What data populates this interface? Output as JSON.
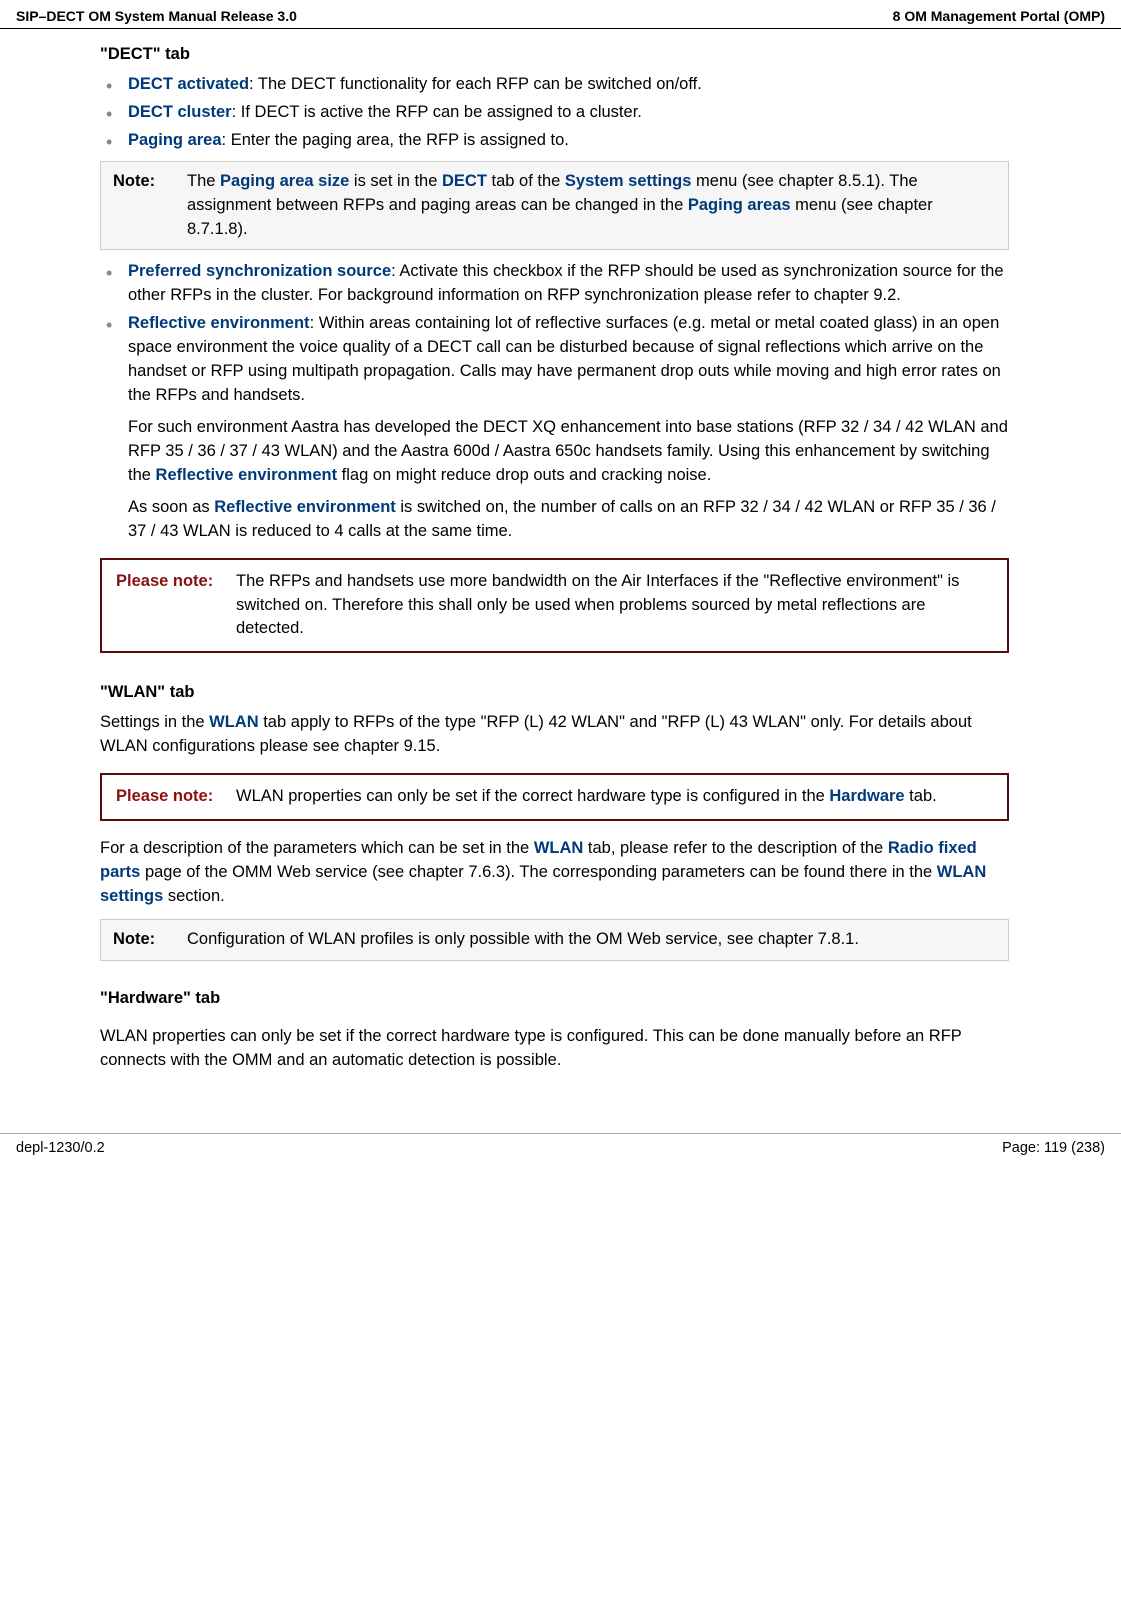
{
  "header": {
    "left": "SIP–DECT OM System Manual Release 3.0",
    "right": "8 OM Management Portal (OMP)"
  },
  "sections": {
    "dectTab": {
      "title": "\"DECT\" tab",
      "items": {
        "dectActivated": {
          "term": "DECT activated",
          "text": ": The DECT functionality for each RFP can be switched on/off."
        },
        "dectCluster": {
          "term": "DECT cluster",
          "text": ": If DECT is active the RFP can be assigned to a cluster."
        },
        "pagingArea": {
          "term": "Paging area",
          "text": ": Enter the paging area, the RFP is assigned to."
        },
        "prefSync": {
          "term": "Preferred synchronization source",
          "text": ": Activate this checkbox if the RFP should be used as synchronization source for the other RFPs in the cluster. For background information on RFP synchronization please refer to chapter 9.2."
        },
        "reflective": {
          "term": "Reflective environment",
          "text": ": Within areas containing lot of reflective surfaces (e.g. metal or metal coated glass) in an open space environment the voice quality of a DECT call can be disturbed because of signal reflections which arrive on the handset or RFP using multipath propagation. Calls may have permanent drop outs while moving and high error rates on the RFPs and handsets."
        }
      },
      "continuations": {
        "p1_a": "For such environment Aastra has developed the DECT XQ enhancement into base stations (RFP 32 / 34 / 42 WLAN and RFP 35 / 36 / 37 / 43 WLAN) and the Aastra 600d / Aastra 650c handsets family. Using this enhancement by switching the ",
        "p1_term": "Reflective environment",
        "p1_b": " flag on might reduce drop outs and cracking noise.",
        "p2_a": "As soon as ",
        "p2_term": "Reflective environment",
        "p2_b": " is switched on, the number of calls on an RFP 32 / 34 / 42 WLAN or RFP 35 / 36 / 37 / 43 WLAN is reduced to 4 calls at the same time."
      }
    },
    "note1": {
      "label": "Note:",
      "a": "The ",
      "t1": "Paging area size",
      "b": " is set in the ",
      "t2": "DECT",
      "c": " tab of the ",
      "t3": "System settings",
      "d": " menu (see chapter 8.5.1). The assignment between RFPs and paging areas can be changed in the ",
      "t4": "Paging areas",
      "e": " menu (see chapter 8.7.1.8)."
    },
    "pleaseNote1": {
      "label": "Please note:",
      "text": "The RFPs and handsets use more bandwidth on the Air Interfaces if the \"Reflective environment\" is switched on. Therefore this shall only be used when problems sourced by metal reflections are detected."
    },
    "wlanTab": {
      "title": "\"WLAN\" tab",
      "intro_a": "Settings in the ",
      "intro_t1": "WLAN",
      "intro_b": " tab apply to RFPs of the type \"RFP (L) 42 WLAN\" and \"RFP (L) 43 WLAN\" only. For details about WLAN configurations please see chapter 9.15.",
      "desc_a": "For a description of the parameters which can be set in the ",
      "desc_t1": "WLAN",
      "desc_b": " tab, please refer to the description of the ",
      "desc_t2": "Radio fixed parts",
      "desc_c": " page of the OMM Web service (see chapter 7.6.3). The corresponding parameters can be found there in the ",
      "desc_t3": "WLAN settings",
      "desc_d": " section."
    },
    "pleaseNote2": {
      "label": "Please note:",
      "a": "WLAN properties can only be set if the correct hardware type is configured in the ",
      "t1": "Hardware",
      "b": " tab."
    },
    "note2": {
      "label": "Note:",
      "text": "Configuration of WLAN profiles is only possible with the OM Web service, see chapter 7.8.1."
    },
    "hardwareTab": {
      "title": "\"Hardware\" tab",
      "text": "WLAN properties can only be set if the correct hardware type is configured. This can be done manually before an RFP connects with the OMM and an automatic detection is possible."
    }
  },
  "footer": {
    "left": "depl-1230/0.2",
    "right": "Page: 119 (238)"
  }
}
